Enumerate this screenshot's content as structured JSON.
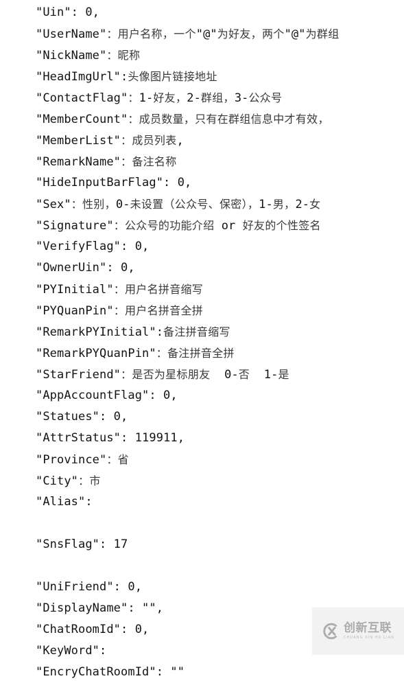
{
  "document": {
    "type": "code-listing",
    "language": "json",
    "description": "WeChat contact object JSON field reference with Chinese annotations",
    "background_color": "#ffffff",
    "text_color": "#131313",
    "annotation_color": "#3a3a3a"
  },
  "lines": [
    {
      "id": "uin",
      "text": "\"Uin\": 0,"
    },
    {
      "id": "username",
      "text": "\"UserName\"：用户名称，一个\"@\"为好友，两个\"@\"为群组"
    },
    {
      "id": "nickname",
      "text": "\"NickName\"：昵称"
    },
    {
      "id": "headimgurl",
      "text": "\"HeadImgUrl\":头像图片链接地址"
    },
    {
      "id": "contactflag",
      "text": "\"ContactFlag\"：1-好友，2-群组，3-公众号"
    },
    {
      "id": "membercount",
      "text": "\"MemberCount\"：成员数量，只有在群组信息中才有效，"
    },
    {
      "id": "memberlist",
      "text": "\"MemberList\"：成员列表,"
    },
    {
      "id": "remarkname",
      "text": "\"RemarkName\"：备注名称"
    },
    {
      "id": "hideinputbarflag",
      "text": "\"HideInputBarFlag\": 0,"
    },
    {
      "id": "sex",
      "text": "\"Sex\"：性别，0-未设置（公众号、保密），1-男，2-女"
    },
    {
      "id": "signature",
      "text": "\"Signature\"：公众号的功能介绍 or 好友的个性签名"
    },
    {
      "id": "verifyflag",
      "text": "\"VerifyFlag\": 0,"
    },
    {
      "id": "owneruin",
      "text": "\"OwnerUin\": 0,"
    },
    {
      "id": "pyinitial",
      "text": "\"PYInitial\"：用户名拼音缩写"
    },
    {
      "id": "pyquanpin",
      "text": "\"PYQuanPin\"：用户名拼音全拼"
    },
    {
      "id": "remarkpyinitial",
      "text": "\"RemarkPYInitial\":备注拼音缩写"
    },
    {
      "id": "remarkpyquanpin",
      "text": "\"RemarkPYQuanPin\"：备注拼音全拼"
    },
    {
      "id": "starfriend",
      "text": "\"StarFriend\"：是否为星标朋友  0-否  1-是"
    },
    {
      "id": "appaccountflag",
      "text": "\"AppAccountFlag\": 0,"
    },
    {
      "id": "statues",
      "text": "\"Statues\": 0,"
    },
    {
      "id": "attrstatus",
      "text": "\"AttrStatus\": 119911,"
    },
    {
      "id": "province",
      "text": "\"Province\"：省"
    },
    {
      "id": "city",
      "text": "\"City\"：市"
    },
    {
      "id": "alias",
      "text": "\"Alias\":"
    },
    {
      "id": "blank-1",
      "text": ""
    },
    {
      "id": "snsflag",
      "text": "\"SnsFlag\": 17"
    },
    {
      "id": "blank-2",
      "text": ""
    },
    {
      "id": "unifriend",
      "text": "\"UniFriend\": 0,"
    },
    {
      "id": "displayname",
      "text": "\"DisplayName\": \"\","
    },
    {
      "id": "chatroomid",
      "text": "\"ChatRoomId\": 0,"
    },
    {
      "id": "keyword",
      "text": "\"KeyWord\":"
    },
    {
      "id": "encrychatroomid",
      "text": "\"EncryChatRoomId\": \"\""
    }
  ],
  "watermark": {
    "logo_icon": "circle-x-logo-icon",
    "brand_cn": "创新互联",
    "brand_pinyin": "CHUANG XIN HU LIAN",
    "background_color": "#f2f2f2",
    "text_color": "#a8a8a8"
  }
}
